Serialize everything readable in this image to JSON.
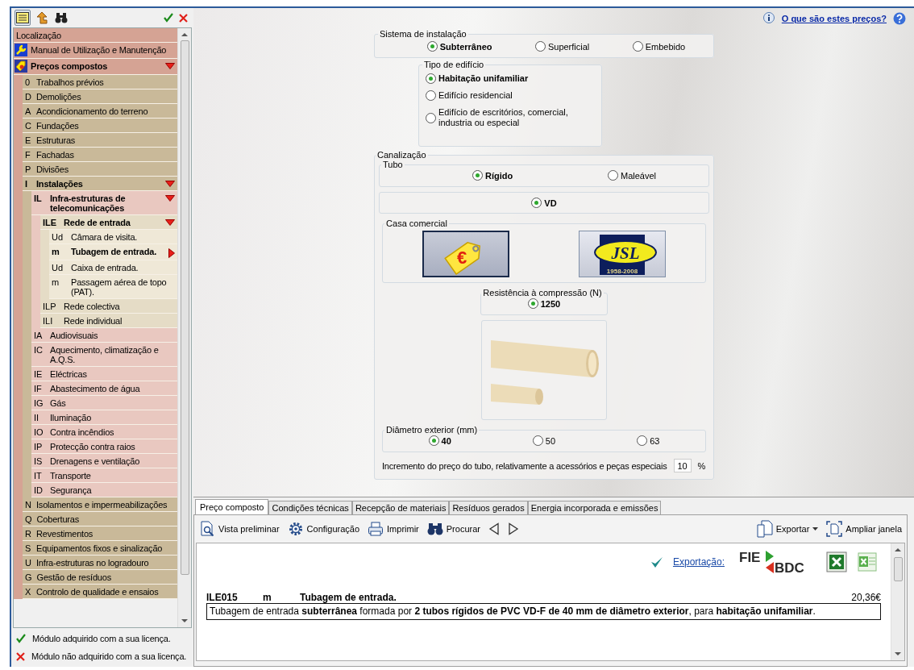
{
  "sidebar": {
    "toolbar": [
      {
        "kind": "list",
        "pressed": true
      },
      {
        "kind": "up",
        "pressed": false
      },
      {
        "kind": "find",
        "pressed": false
      }
    ],
    "status_icons": [
      {
        "kind": "acquired"
      },
      {
        "kind": "not_acquired"
      }
    ],
    "tree": [
      {
        "label": "Localização"
      },
      {
        "kind": "manual",
        "label": "Manual de Utilização e Manutenção"
      },
      {
        "kind": "prices",
        "label": "Preços compostos",
        "expanded": true,
        "children": [
          {
            "code": "0",
            "label": "Trabalhos prévios"
          },
          {
            "code": "D",
            "label": "Demolições"
          },
          {
            "code": "A",
            "label": "Acondicionamento do terreno"
          },
          {
            "code": "C",
            "label": "Fundações"
          },
          {
            "code": "E",
            "label": "Estruturas"
          },
          {
            "code": "F",
            "label": "Fachadas"
          },
          {
            "code": "P",
            "label": "Divisões"
          },
          {
            "code": "I",
            "label": "Instalações",
            "expanded": true,
            "children": [
              {
                "code": "IL",
                "label": "Infra-estruturas de telecomunicações",
                "expanded": true,
                "children": [
                  {
                    "code": "ILE",
                    "label": "Rede de entrada",
                    "expanded": true,
                    "children": [
                      {
                        "code": "Ud",
                        "label": "Câmara de visita.",
                        "selected": false
                      },
                      {
                        "code": "m",
                        "label": "Tubagem de entrada.",
                        "selected": true
                      },
                      {
                        "code": "Ud",
                        "label": "Caixa de entrada.",
                        "selected": false
                      },
                      {
                        "code": "m",
                        "label": "Passagem aérea de topo (PAT).",
                        "selected": false
                      }
                    ]
                  },
                  {
                    "code": "ILP",
                    "label": "Rede colectiva"
                  },
                  {
                    "code": "ILI",
                    "label": "Rede individual"
                  }
                ]
              },
              {
                "code": "IA",
                "label": "Audiovisuais"
              },
              {
                "code": "IC",
                "label": "Aquecimento, climatização e A.Q.S."
              },
              {
                "code": "IE",
                "label": "Eléctricas"
              },
              {
                "code": "IF",
                "label": "Abastecimento de água"
              },
              {
                "code": "IG",
                "label": "Gás"
              },
              {
                "code": "II",
                "label": "Iluminação"
              },
              {
                "code": "IO",
                "label": "Contra incêndios"
              },
              {
                "code": "IP",
                "label": "Protecção contra raios"
              },
              {
                "code": "IS",
                "label": "Drenagens e ventilação"
              },
              {
                "code": "IT",
                "label": "Transporte"
              },
              {
                "code": "ID",
                "label": "Segurança"
              }
            ]
          },
          {
            "code": "N",
            "label": "Isolamentos e impermeabilizações"
          },
          {
            "code": "Q",
            "label": "Coberturas"
          },
          {
            "code": "R",
            "label": "Revestimentos"
          },
          {
            "code": "S",
            "label": "Equipamentos fixos e sinalização"
          },
          {
            "code": "U",
            "label": "Infra-estruturas no logradouro"
          },
          {
            "code": "G",
            "label": "Gestão de resíduos"
          },
          {
            "code": "X",
            "label": "Controlo de qualidade e ensaios"
          }
        ]
      }
    ],
    "legend": [
      {
        "kind": "acquired",
        "text": "Módulo adquirido com a sua licença."
      },
      {
        "kind": "not_acquired",
        "text": "Módulo não adquirido com a sua licença."
      }
    ]
  },
  "help_link": "O que são estes preços?",
  "form": {
    "installation_system": {
      "legend": "Sistema de instalação",
      "options": [
        {
          "label": "Subterrâneo",
          "selected": true
        },
        {
          "label": "Superficial",
          "selected": false
        },
        {
          "label": "Embebido",
          "selected": false
        }
      ]
    },
    "building_type": {
      "legend": "Tipo de edifício",
      "options": [
        {
          "label": "Habitação unifamiliar",
          "selected": true
        },
        {
          "label": "Edifício residencial",
          "selected": false
        },
        {
          "label": "Edifício de escritórios, comercial, industria ou especial",
          "selected": false
        }
      ]
    },
    "piping": {
      "legend": "Canalização",
      "tube": {
        "legend": "Tubo",
        "options": [
          {
            "label": "Rígido",
            "selected": true
          },
          {
            "label": "Maleável",
            "selected": false
          }
        ]
      },
      "material": {
        "options": [
          {
            "label": "VD",
            "selected": true
          }
        ]
      },
      "manufacturer": {
        "legend": "Casa comercial",
        "options": [
          {
            "kind": "price_tag",
            "symbol": "€",
            "selected": true
          },
          {
            "kind": "logo",
            "text": "JSL",
            "subtext": "1958-2008",
            "selected": false
          }
        ]
      },
      "compression": {
        "legend": "Resistência à compressão (N)",
        "options": [
          {
            "label": "1250",
            "selected": true
          }
        ]
      },
      "diameter": {
        "legend": "Diâmetro exterior (mm)",
        "options": [
          {
            "label": "40",
            "selected": true
          },
          {
            "label": "50",
            "selected": false
          },
          {
            "label": "63",
            "selected": false
          }
        ]
      },
      "increment": {
        "label": "Incremento do preço do tubo, relativamente a acessórios e peças especiais",
        "value": "10",
        "unit": "%"
      }
    }
  },
  "bottom": {
    "tabs": [
      {
        "label": "Preço composto",
        "selected": true
      },
      {
        "label": "Condições técnicas",
        "selected": false
      },
      {
        "label": "Recepção de materiais",
        "selected": false
      },
      {
        "label": "Resíduos gerados",
        "selected": false
      },
      {
        "label": "Energia incorporada e emissões",
        "selected": false
      }
    ],
    "toolbar": [
      {
        "kind": "preview",
        "label": "Vista preliminar"
      },
      {
        "kind": "settings",
        "label": "Configuração"
      },
      {
        "kind": "print",
        "label": "Imprimir"
      },
      {
        "kind": "find",
        "label": "Procurar"
      },
      {
        "kind": "prev"
      },
      {
        "kind": "next"
      }
    ],
    "toolbar_right": [
      {
        "kind": "export",
        "label": "Exportar",
        "dropdown": true
      },
      {
        "kind": "expand",
        "label": "Ampliar janela",
        "dropdown": false
      }
    ],
    "export": {
      "link": "Exportação:",
      "formats": [
        {
          "kind": "fiebdc",
          "text": "FIE",
          "subtext": "BDC"
        },
        {
          "kind": "excel"
        },
        {
          "kind": "excel_light"
        }
      ]
    },
    "record": {
      "code": "ILE015",
      "unit": "m",
      "title": "Tubagem de entrada.",
      "price": "20,36€",
      "description": "Tubagem de entrada **subterrânea** formada por **2 tubos rígidos de PVC VD-F de 40 mm de diâmetro exterior**, para **habitação unifamiliar**."
    }
  }
}
